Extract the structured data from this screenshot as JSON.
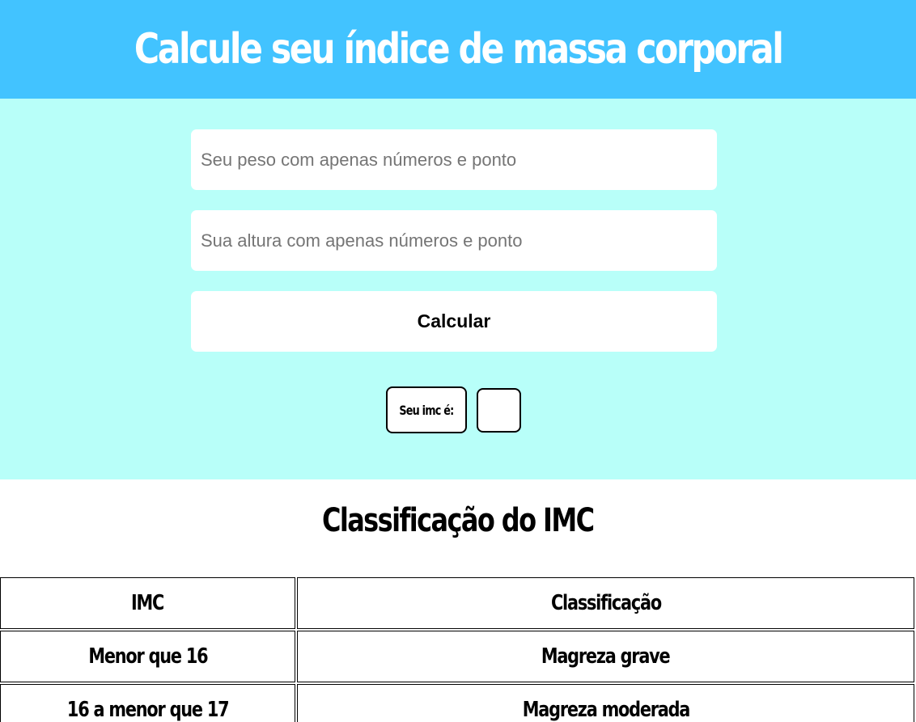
{
  "header": {
    "title": "Calcule seu índice de massa corporal",
    "background": "#42c3ff"
  },
  "form": {
    "background": "#b8fff9",
    "weight_placeholder": "Seu peso com apenas números e ponto",
    "weight_value": "",
    "height_placeholder": "Sua altura com apenas números e ponto",
    "height_value": "",
    "calculate_label": "Calcular",
    "result_label": "Seu imc é:",
    "result_value": ""
  },
  "classification": {
    "title": "Classificação do IMC",
    "columns": [
      "IMC",
      "Classificação"
    ],
    "rows": [
      {
        "imc": "Menor que 16",
        "classification": "Magreza grave"
      },
      {
        "imc": "16 a menor que 17",
        "classification": "Magreza moderada"
      }
    ]
  }
}
